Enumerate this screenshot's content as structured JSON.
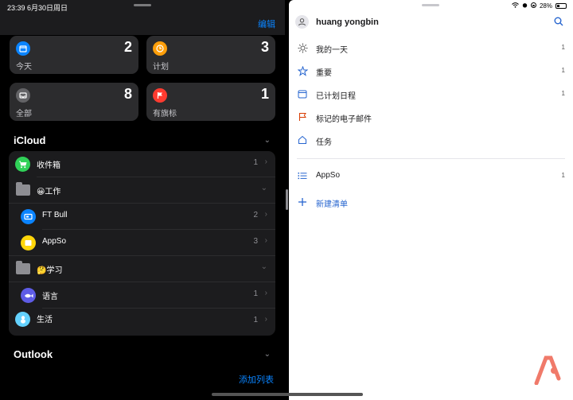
{
  "left_pane": {
    "status_time": "23:39  6月30日周日",
    "edit_label": "编辑",
    "cards": [
      {
        "label": "今天",
        "count": "2",
        "icon": "calendar-icon",
        "color": "#0a84ff"
      },
      {
        "label": "计划",
        "count": "3",
        "icon": "clock-icon",
        "color": "#ff9f0a"
      },
      {
        "label": "全部",
        "count": "8",
        "icon": "tray-icon",
        "color": "#636366"
      },
      {
        "label": "有旗标",
        "count": "1",
        "icon": "flag-icon",
        "color": "#ff3b30"
      }
    ],
    "icloud_title": "iCloud",
    "lists": [
      {
        "label": "收件箱",
        "count": "1",
        "icon": "cart-icon",
        "color": "#30d158"
      },
      {
        "label": "😀工作",
        "icon": "folder-icon"
      },
      {
        "label": "FT Bull",
        "count": "2",
        "icon": "cards-icon",
        "color": "#0a84ff"
      },
      {
        "label": "AppSo",
        "count": "3",
        "icon": "list-icon",
        "color": "#ffd60a"
      },
      {
        "label": "🤔学习",
        "icon": "folder-icon"
      },
      {
        "label": "语言",
        "count": "1",
        "icon": "fish-icon",
        "color": "#5e5ce6"
      },
      {
        "label": "生活",
        "count": "1",
        "icon": "teddy-icon",
        "color": "#64d2ff"
      }
    ],
    "outlook_title": "Outlook",
    "add_list_label": "添加列表"
  },
  "right_pane": {
    "status_battery": "28%",
    "user_name": "huang yongbin",
    "menu": [
      {
        "label": "我的一天",
        "count": "1",
        "icon": "sun-icon"
      },
      {
        "label": "重要",
        "count": "1",
        "icon": "star-icon"
      },
      {
        "label": "已计划日程",
        "count": "1",
        "icon": "calendar-icon"
      },
      {
        "label": "标记的电子邮件",
        "count": "",
        "icon": "flag-icon"
      },
      {
        "label": "任务",
        "count": "",
        "icon": "home-icon"
      }
    ],
    "lists": [
      {
        "label": "AppSo",
        "count": "1",
        "icon": "list-icon"
      }
    ],
    "new_list_label": "新建清单"
  }
}
